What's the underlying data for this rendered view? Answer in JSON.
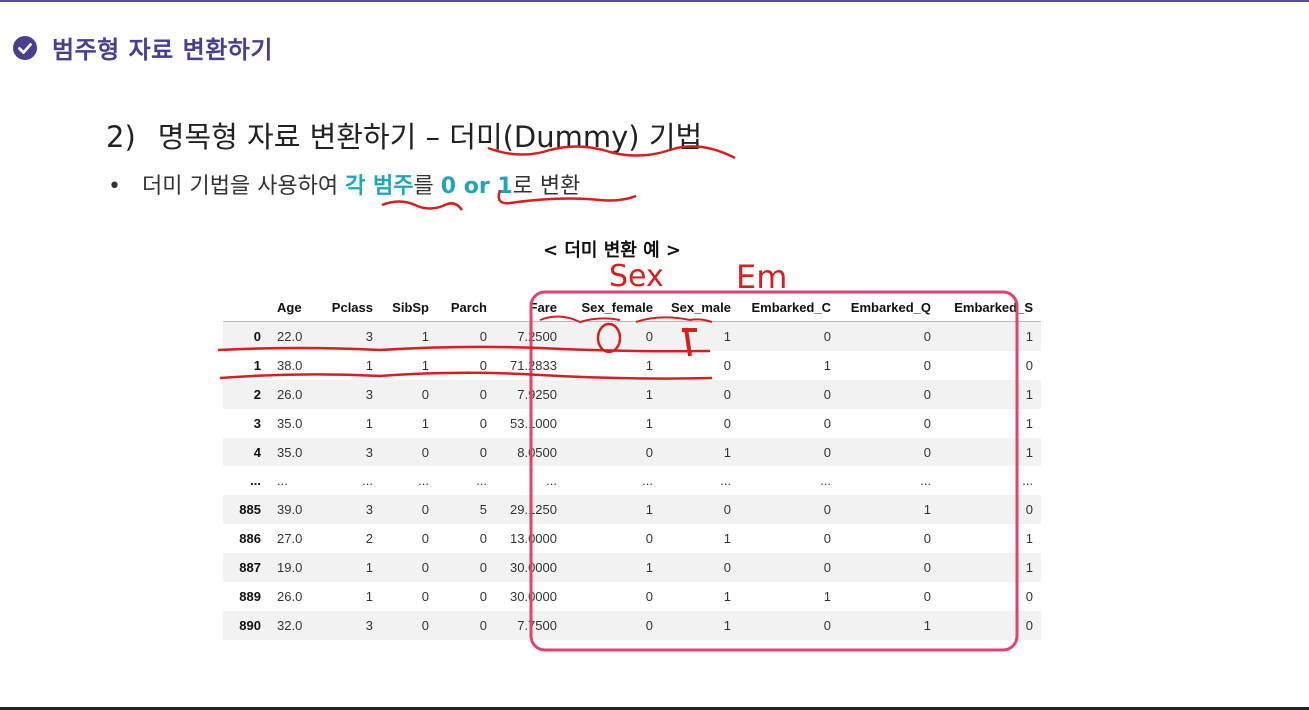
{
  "section": {
    "icon": "check-circle-icon",
    "title": "범주형 자료 변환하기"
  },
  "subheading": {
    "number": "2)",
    "text": "명목형 자료 변환하기 – 더미(Dummy) 기법"
  },
  "bullet": {
    "marker": "•",
    "prefix": "더미 기법을 사용하여 ",
    "highlight1": "각 범주",
    "mid": "를 ",
    "highlight2": "0 or 1",
    "suffix": "로 변환"
  },
  "caption": "< 더미 변환 예 >",
  "handwriting": {
    "sex": "Sex",
    "em": "Em"
  },
  "colors": {
    "accent_purple": "#4b3d8f",
    "highlight_teal": "#1fa6b8",
    "box_pink": "#e0446e",
    "annotation_red": "#d61f1f"
  },
  "table": {
    "columns": [
      "",
      "Age",
      "Pclass",
      "SibSp",
      "Parch",
      "Fare",
      "Sex_female",
      "Sex_male",
      "Embarked_C",
      "Embarked_Q",
      "Embarked_S"
    ],
    "rows": [
      [
        "0",
        "22.0",
        "3",
        "1",
        "0",
        "7.2500",
        "0",
        "1",
        "0",
        "0",
        "1"
      ],
      [
        "1",
        "38.0",
        "1",
        "1",
        "0",
        "71.2833",
        "1",
        "0",
        "1",
        "0",
        "0"
      ],
      [
        "2",
        "26.0",
        "3",
        "0",
        "0",
        "7.9250",
        "1",
        "0",
        "0",
        "0",
        "1"
      ],
      [
        "3",
        "35.0",
        "1",
        "1",
        "0",
        "53.1000",
        "1",
        "0",
        "0",
        "0",
        "1"
      ],
      [
        "4",
        "35.0",
        "3",
        "0",
        "0",
        "8.0500",
        "0",
        "1",
        "0",
        "0",
        "1"
      ],
      [
        "...",
        "...",
        "...",
        "...",
        "...",
        "...",
        "...",
        "...",
        "...",
        "...",
        "..."
      ],
      [
        "885",
        "39.0",
        "3",
        "0",
        "5",
        "29.1250",
        "1",
        "0",
        "0",
        "1",
        "0"
      ],
      [
        "886",
        "27.0",
        "2",
        "0",
        "0",
        "13.0000",
        "0",
        "1",
        "0",
        "0",
        "1"
      ],
      [
        "887",
        "19.0",
        "1",
        "0",
        "0",
        "30.0000",
        "1",
        "0",
        "0",
        "0",
        "1"
      ],
      [
        "889",
        "26.0",
        "1",
        "0",
        "0",
        "30.0000",
        "0",
        "1",
        "1",
        "0",
        "0"
      ],
      [
        "890",
        "32.0",
        "3",
        "0",
        "0",
        "7.7500",
        "0",
        "1",
        "0",
        "1",
        "0"
      ]
    ]
  }
}
